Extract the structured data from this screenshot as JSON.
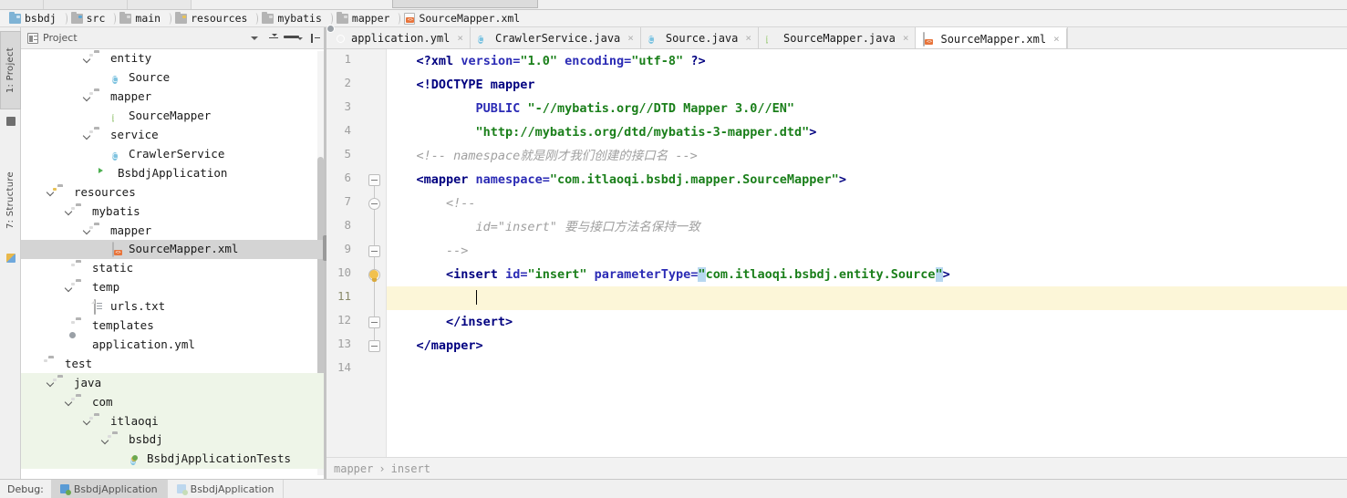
{
  "breadcrumb": [
    {
      "label": "bsbdj",
      "icon": "module-folder-icon"
    },
    {
      "label": "src",
      "icon": "folder-icon"
    },
    {
      "label": "main",
      "icon": "folder-icon"
    },
    {
      "label": "resources",
      "icon": "resources-folder-icon"
    },
    {
      "label": "mybatis",
      "icon": "folder-icon"
    },
    {
      "label": "mapper",
      "icon": "folder-icon"
    },
    {
      "label": "SourceMapper.xml",
      "icon": "xml-file-icon"
    }
  ],
  "tool_strip": [
    {
      "label": "1: Project",
      "icon": "project-icon",
      "active": true
    },
    {
      "label": "7: Structure",
      "icon": "structure-icon",
      "active": false
    }
  ],
  "project_panel": {
    "title": "Project",
    "tools": [
      "view-mode-dropdown",
      "collapse-all-icon",
      "settings-gear-icon",
      "hide-panel-icon"
    ],
    "tree": [
      {
        "label": "entity",
        "indent": 3,
        "twisty": "open",
        "icon": "folder-icon"
      },
      {
        "label": "Source",
        "indent": 4,
        "twisty": "none",
        "icon": "class-icon"
      },
      {
        "label": "mapper",
        "indent": 3,
        "twisty": "open",
        "icon": "folder-icon"
      },
      {
        "label": "SourceMapper",
        "indent": 4,
        "twisty": "none",
        "icon": "interface-icon"
      },
      {
        "label": "service",
        "indent": 3,
        "twisty": "open",
        "icon": "folder-icon"
      },
      {
        "label": "CrawlerService",
        "indent": 4,
        "twisty": "none",
        "icon": "class-icon"
      },
      {
        "label": "BsbdjApplication",
        "indent": 3.4,
        "twisty": "none",
        "icon": "spring-boot-icon"
      },
      {
        "label": "resources",
        "indent": 1,
        "twisty": "open",
        "icon": "resources-folder-icon"
      },
      {
        "label": "mybatis",
        "indent": 2,
        "twisty": "open",
        "icon": "folder-icon"
      },
      {
        "label": "mapper",
        "indent": 3,
        "twisty": "open",
        "icon": "folder-icon"
      },
      {
        "label": "SourceMapper.xml",
        "indent": 4,
        "twisty": "none",
        "icon": "xml-file-icon",
        "selected": true
      },
      {
        "label": "static",
        "indent": 2,
        "twisty": "none",
        "icon": "folder-icon"
      },
      {
        "label": "temp",
        "indent": 2,
        "twisty": "open",
        "icon": "folder-icon"
      },
      {
        "label": "urls.txt",
        "indent": 3,
        "twisty": "none",
        "icon": "text-file-icon"
      },
      {
        "label": "templates",
        "indent": 2,
        "twisty": "none",
        "icon": "folder-icon"
      },
      {
        "label": "application.yml",
        "indent": 2,
        "twisty": "none",
        "icon": "yaml-file-icon"
      },
      {
        "label": "test",
        "indent": 0.5,
        "twisty": "none",
        "icon": "folder-icon"
      },
      {
        "label": "java",
        "indent": 1,
        "twisty": "open",
        "icon": "test-source-folder-icon",
        "testbg": true
      },
      {
        "label": "com",
        "indent": 2,
        "twisty": "open",
        "icon": "folder-icon",
        "testbg": true
      },
      {
        "label": "itlaoqi",
        "indent": 3,
        "twisty": "open",
        "icon": "folder-icon",
        "testbg": true
      },
      {
        "label": "bsbdj",
        "indent": 4,
        "twisty": "open",
        "icon": "folder-icon",
        "testbg": true
      },
      {
        "label": "BsbdjApplicationTests",
        "indent": 5,
        "twisty": "none",
        "icon": "test-class-icon",
        "testbg": true
      }
    ]
  },
  "editor": {
    "tabs": [
      {
        "label": "application.yml",
        "icon": "yaml-file-icon",
        "active": false
      },
      {
        "label": "CrawlerService.java",
        "icon": "class-icon",
        "active": false
      },
      {
        "label": "Source.java",
        "icon": "class-icon",
        "active": false
      },
      {
        "label": "SourceMapper.java",
        "icon": "interface-icon",
        "active": false
      },
      {
        "label": "SourceMapper.xml",
        "icon": "xml-file-icon",
        "active": true
      }
    ],
    "line_numbers": [
      "1",
      "2",
      "3",
      "4",
      "5",
      "6",
      "7",
      "8",
      "9",
      "10",
      "11",
      "12",
      "13",
      "14"
    ],
    "current_line": 11,
    "breadcrumb": [
      "mapper",
      "insert"
    ],
    "breadcrumb_separator": "›",
    "code": [
      {
        "n": 1,
        "segs": [
          {
            "t": "    ",
            "c": "plain"
          },
          {
            "t": "<?",
            "c": "tag"
          },
          {
            "t": "xml",
            "c": "tag"
          },
          {
            "t": " ",
            "c": "plain"
          },
          {
            "t": "version=",
            "c": "attr"
          },
          {
            "t": "\"1.0\"",
            "c": "val"
          },
          {
            "t": " ",
            "c": "plain"
          },
          {
            "t": "encoding=",
            "c": "attr"
          },
          {
            "t": "\"utf-8\"",
            "c": "val"
          },
          {
            "t": " ",
            "c": "plain"
          },
          {
            "t": "?>",
            "c": "tag"
          }
        ]
      },
      {
        "n": 2,
        "segs": [
          {
            "t": "    ",
            "c": "plain"
          },
          {
            "t": "<!DOCTYPE ",
            "c": "tag"
          },
          {
            "t": "mapper",
            "c": "tag"
          }
        ]
      },
      {
        "n": 3,
        "segs": [
          {
            "t": "            ",
            "c": "plain"
          },
          {
            "t": "PUBLIC ",
            "c": "attr"
          },
          {
            "t": "\"-//mybatis.org//DTD Mapper 3.0//EN\"",
            "c": "val"
          }
        ]
      },
      {
        "n": 4,
        "segs": [
          {
            "t": "            ",
            "c": "plain"
          },
          {
            "t": "\"http://mybatis.org/dtd/mybatis-3-mapper.dtd\"",
            "c": "val"
          },
          {
            "t": ">",
            "c": "tag"
          }
        ]
      },
      {
        "n": 5,
        "segs": [
          {
            "t": "    <!-- namespace就是刚才我们创建的接口名 -->",
            "c": "cmt"
          }
        ]
      },
      {
        "n": 6,
        "segs": [
          {
            "t": "    ",
            "c": "plain"
          },
          {
            "t": "<mapper ",
            "c": "tag"
          },
          {
            "t": "namespace=",
            "c": "attr"
          },
          {
            "t": "\"com.itlaoqi.bsbdj.mapper.SourceMapper\"",
            "c": "val"
          },
          {
            "t": ">",
            "c": "tag"
          }
        ]
      },
      {
        "n": 7,
        "segs": [
          {
            "t": "        <!--",
            "c": "cmt"
          }
        ]
      },
      {
        "n": 8,
        "segs": [
          {
            "t": "            id=\"insert\" 要与接口方法名保持一致",
            "c": "cmt"
          }
        ]
      },
      {
        "n": 9,
        "segs": [
          {
            "t": "        -->",
            "c": "cmt"
          }
        ]
      },
      {
        "n": 10,
        "segs": [
          {
            "t": "        ",
            "c": "plain"
          },
          {
            "t": "<insert ",
            "c": "tag"
          },
          {
            "t": "id=",
            "c": "attr"
          },
          {
            "t": "\"insert\"",
            "c": "val"
          },
          {
            "t": " ",
            "c": "plain"
          },
          {
            "t": "parameterType=",
            "c": "attr"
          },
          {
            "t": "\"",
            "c": "val qhl"
          },
          {
            "t": "com.itlaoqi.bsbdj.entity.Source",
            "c": "val"
          },
          {
            "t": "\"",
            "c": "val qhl"
          },
          {
            "t": ">",
            "c": "tag"
          }
        ]
      },
      {
        "n": 11,
        "segs": [
          {
            "t": "            ",
            "c": "plain"
          }
        ],
        "caret": true
      },
      {
        "n": 12,
        "segs": [
          {
            "t": "        ",
            "c": "plain"
          },
          {
            "t": "</insert>",
            "c": "tag"
          }
        ]
      },
      {
        "n": 13,
        "segs": [
          {
            "t": "    ",
            "c": "plain"
          },
          {
            "t": "</mapper>",
            "c": "tag"
          }
        ]
      },
      {
        "n": 14,
        "segs": []
      }
    ],
    "fold_markers": [
      {
        "line": 6,
        "shape": "square"
      },
      {
        "line": 7,
        "shape": "round"
      },
      {
        "line": 9,
        "shape": "square"
      },
      {
        "line": 10,
        "shape": "round"
      },
      {
        "line": 12,
        "shape": "square"
      },
      {
        "line": 13,
        "shape": "square"
      }
    ],
    "intention_bulb_line": 10
  },
  "debug_bar": {
    "label": "Debug:",
    "tabs": [
      {
        "label": "BsbdjApplication",
        "active": true
      },
      {
        "label": "BsbdjApplication",
        "active": false
      }
    ]
  },
  "colors": {
    "tag": "#000080",
    "attribute": "#2b2bb5",
    "value": "#1a7f1a",
    "comment": "#a0a0a0",
    "caret_line": "#fcf6d8",
    "selection_highlight": "#b8d8f0",
    "tree_selection": "#d4d4d4",
    "test_root": "#eef5e8"
  }
}
